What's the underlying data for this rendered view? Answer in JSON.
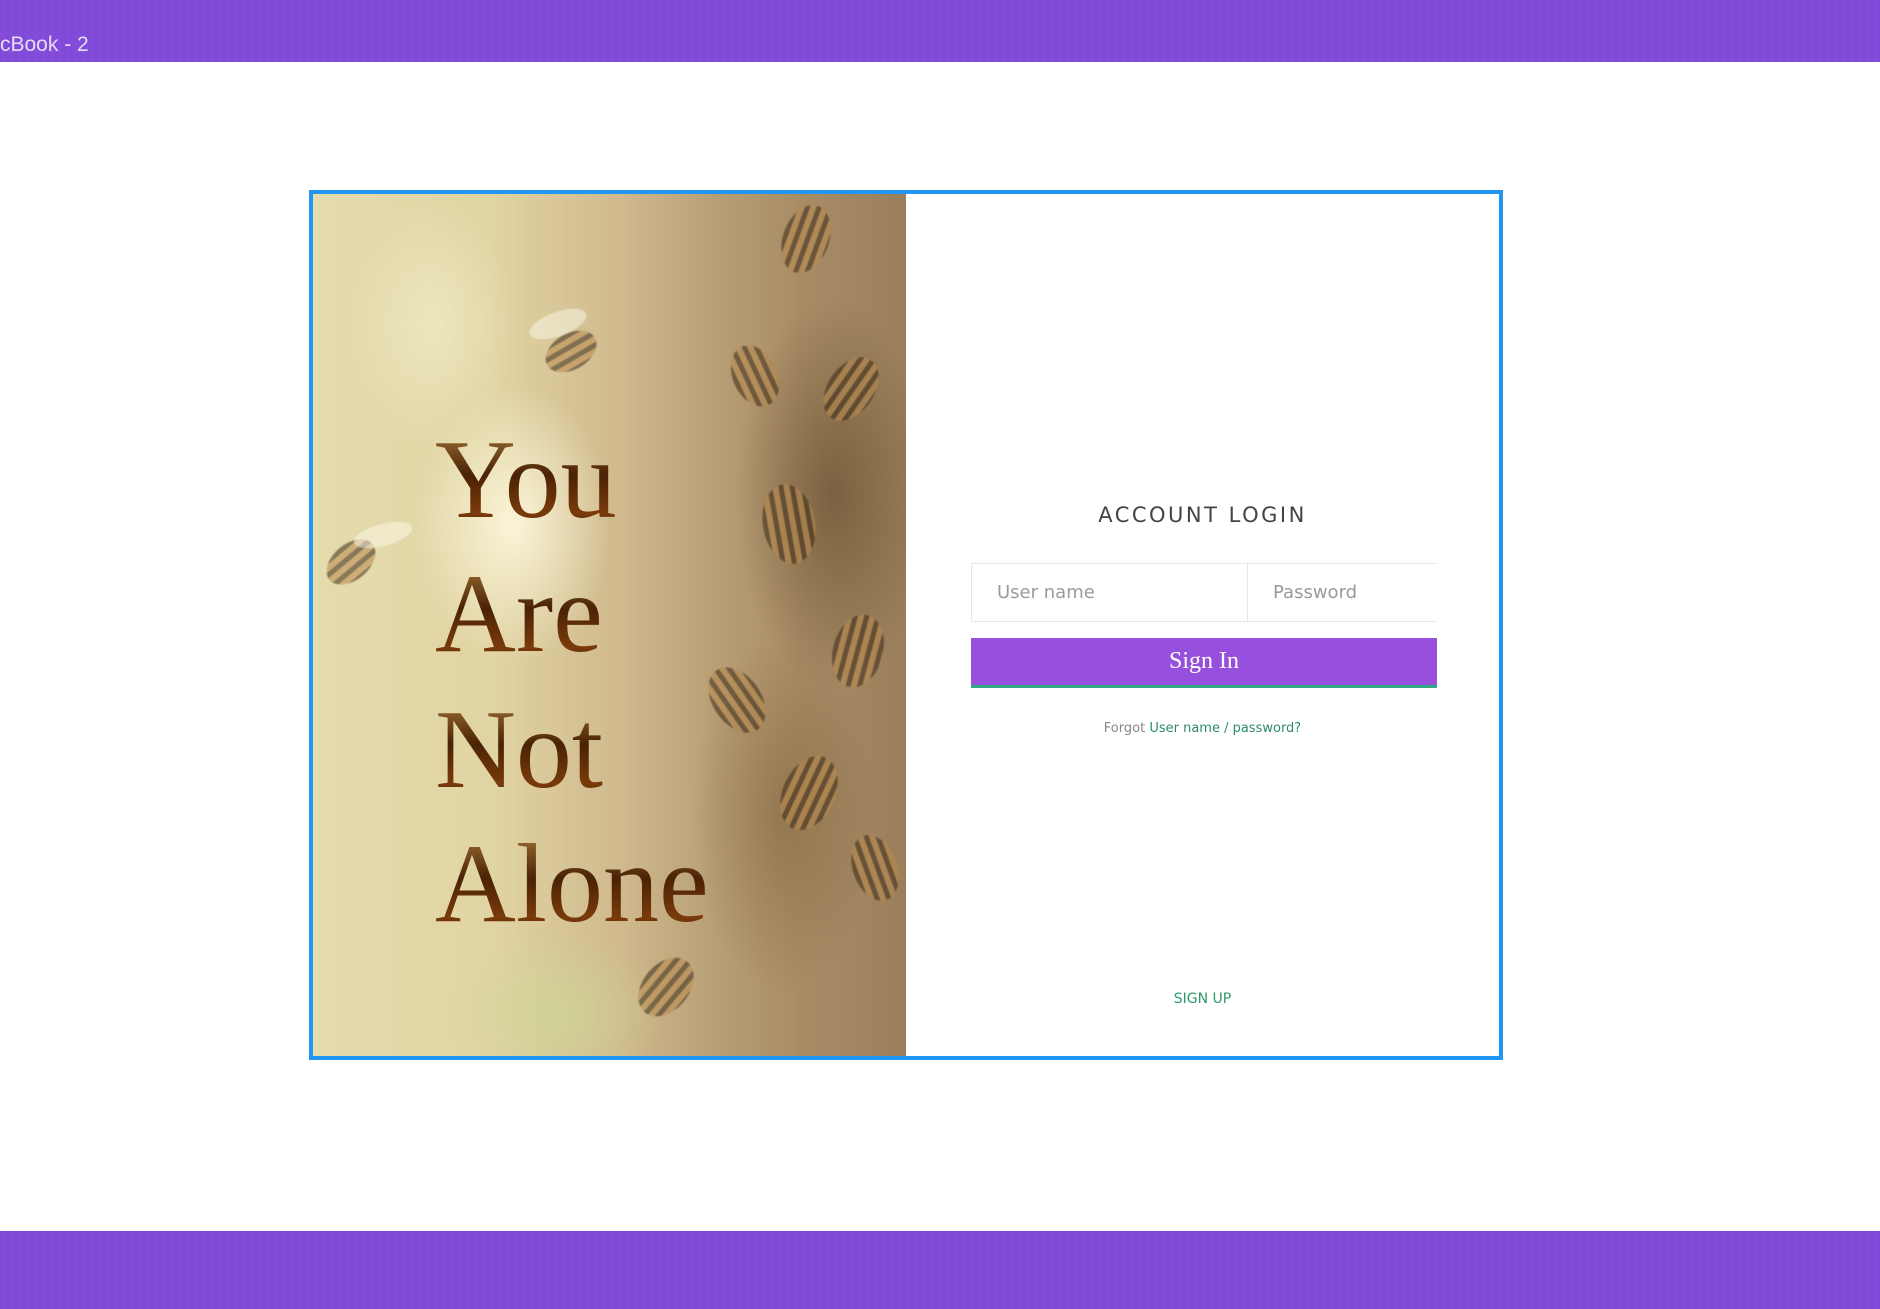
{
  "canvas": {
    "frame_title": "cBook - 2",
    "accent_color": "#814ad8",
    "selection_color": "#2196f3"
  },
  "hero": {
    "lines": [
      "You",
      "Are",
      "Not",
      "Alone"
    ]
  },
  "login": {
    "title": "ACCOUNT LOGIN",
    "username_placeholder": "User name",
    "password_placeholder": "Password",
    "signin_label": "Sign In",
    "button_color": "#9750dd",
    "forgot_prefix": "Forgot",
    "forgot_link": "User name / password?",
    "signup_label": "SIGN UP"
  }
}
